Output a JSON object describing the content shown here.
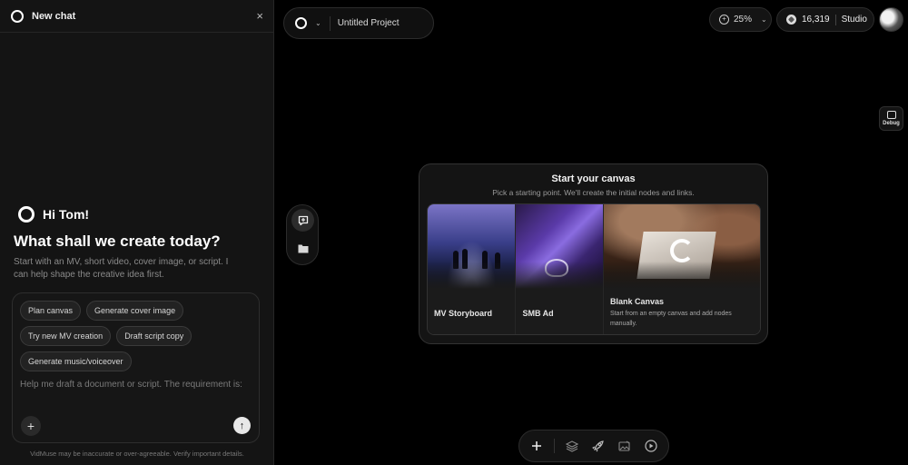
{
  "chat": {
    "header_title": "New chat",
    "close_symbol": "×",
    "greeting": "Hi Tom!",
    "headline": "What shall we create today?",
    "subtext": "Start with an MV, short video, cover image, or script. I can help shape the creative idea first.",
    "chips": [
      "Plan canvas",
      "Generate cover image",
      "Try new MV creation",
      "Draft script copy",
      "Generate music/voiceover"
    ],
    "input_placeholder": "Help me draft a document or script. The requirement is:",
    "add_symbol": "+",
    "send_symbol": "↑",
    "disclaimer": "VidMuse may be inaccurate or over-agreeable. Verify important details."
  },
  "topbar": {
    "project_name": "Untitled Project",
    "zoom": "25%",
    "credits": "16,319",
    "plan": "Studio"
  },
  "debug": {
    "label": "Debug"
  },
  "start_card": {
    "title": "Start your canvas",
    "subtitle": "Pick a starting point. We'll create the initial nodes and links.",
    "options": [
      {
        "label": "MV Storyboard"
      },
      {
        "label": "SMB Ad"
      },
      {
        "label": "Blank Canvas",
        "description": "Start from an empty canvas and add nodes manually."
      }
    ]
  },
  "icons": {
    "logo": "circle-logo-icon",
    "side_tools": [
      "chat-bubble-icon",
      "folder-icon"
    ],
    "bottom_tools": [
      "plus-icon",
      "layers-icon",
      "rocket-icon",
      "image-edit-icon",
      "play-icon"
    ]
  },
  "colors": {
    "background": "#000000",
    "panel": "#141414",
    "border": "#2c2c2c",
    "text": "#e8e8e8"
  }
}
